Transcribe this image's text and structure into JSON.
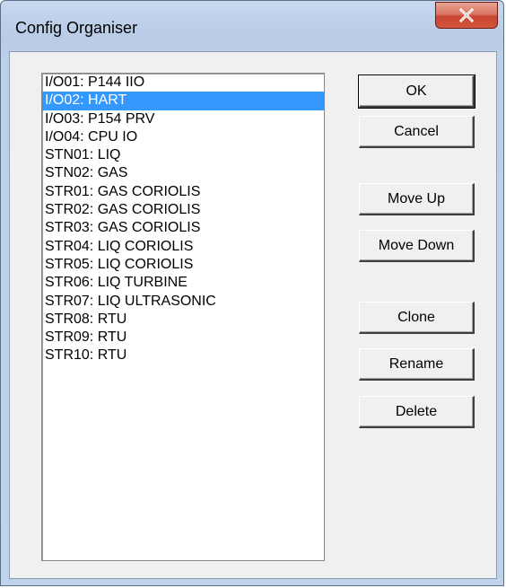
{
  "window": {
    "title": "Config Organiser"
  },
  "list": {
    "items": [
      "I/O01: P144 IIO",
      "I/O02: HART",
      "I/O03: P154 PRV",
      "I/O04: CPU IO",
      "STN01: LIQ",
      "STN02: GAS",
      "STR01: GAS CORIOLIS",
      "STR02: GAS CORIOLIS",
      "STR03: GAS CORIOLIS",
      "STR04: LIQ CORIOLIS",
      "STR05: LIQ CORIOLIS",
      "STR06: LIQ TURBINE",
      "STR07: LIQ ULTRASONIC",
      "STR08: RTU",
      "STR09: RTU",
      "STR10: RTU"
    ],
    "selected_index": 1
  },
  "buttons": {
    "ok": "OK",
    "cancel": "Cancel",
    "move_up": "Move Up",
    "move_down": "Move Down",
    "clone": "Clone",
    "rename": "Rename",
    "delete": "Delete"
  },
  "colors": {
    "selection": "#3399ff",
    "close_button": "#c7442e"
  }
}
